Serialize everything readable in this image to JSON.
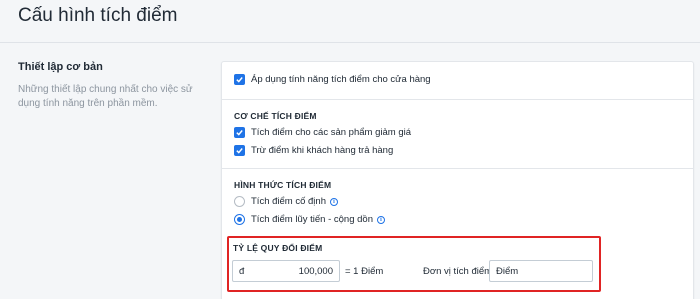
{
  "page": {
    "title": "Cấu hình tích điểm"
  },
  "sidebar": {
    "title": "Thiết lập cơ bản",
    "description": "Những thiết lập chung nhất cho việc sử dụng tính năng trên phần mềm."
  },
  "settings": {
    "apply_label": "Áp dụng tính năng tích điểm cho cửa hàng",
    "apply_checked": true,
    "mechanism": {
      "heading": "CƠ CHẾ TÍCH ĐIỂM",
      "options": [
        {
          "label": "Tích điểm cho các sản phẩm giảm giá",
          "checked": true
        },
        {
          "label": "Trừ điểm khi khách hàng trả hàng",
          "checked": true
        }
      ]
    },
    "method": {
      "heading": "HÌNH THỨC TÍCH ĐIỂM",
      "options": [
        {
          "label": "Tích điểm cố định",
          "selected": false,
          "icon": "info-icon"
        },
        {
          "label": "Tích điểm lũy tiến - cộng dồn",
          "selected": true,
          "icon": "info-icon"
        }
      ]
    },
    "rate": {
      "heading": "TỶ LỆ QUY ĐỔI ĐIỂM",
      "currency_prefix": "đ",
      "amount": "100,000",
      "equals_label": "= 1 Điểm",
      "unit_label": "Đơn vị tích điểm",
      "unit_value": "Điểm"
    }
  },
  "colors": {
    "accent": "#1f73e6",
    "highlight": "#e02424",
    "background": "#f4f6f8"
  }
}
